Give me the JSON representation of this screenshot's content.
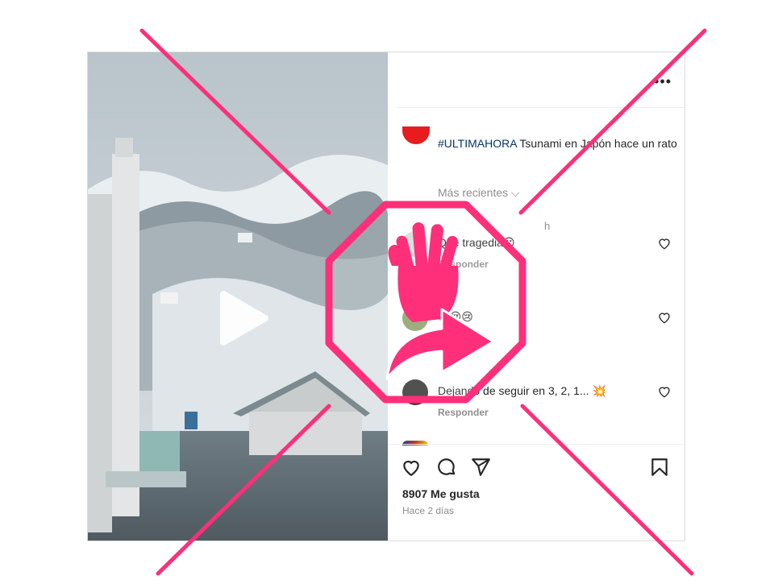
{
  "caption": {
    "hashtag": "#ULTIMAHORA",
    "text": " Tsunami en Japón hace un rato"
  },
  "sort_label": "Más recientes ⌵",
  "time_fragment": "h",
  "comments": [
    {
      "text": "Que tragedia😮",
      "reply_label": "Responder",
      "avatar_color": "#d9d9d9"
    },
    {
      "text": "😢😢😢",
      "reply_label": "Responder",
      "avatar_color": "#8fa36b"
    },
    {
      "text": "Dejando de seguir en 3, 2, 1... 💥",
      "reply_label": "Responder",
      "avatar_color": "#3a3a3a"
    }
  ],
  "likes": "8907 Me gusta",
  "date": "Hace 2 días",
  "icons": {
    "more": "more-options-icon",
    "heart": "heart-icon",
    "comment": "comment-icon",
    "share": "share-icon",
    "save": "bookmark-icon",
    "play": "play-icon",
    "fact_check_stamp": "stop-hand-share-stamp-icon"
  },
  "colors": {
    "stamp": "#ff2f7a",
    "link": "#00376b",
    "muted": "#8e8e8e",
    "text": "#262626"
  }
}
